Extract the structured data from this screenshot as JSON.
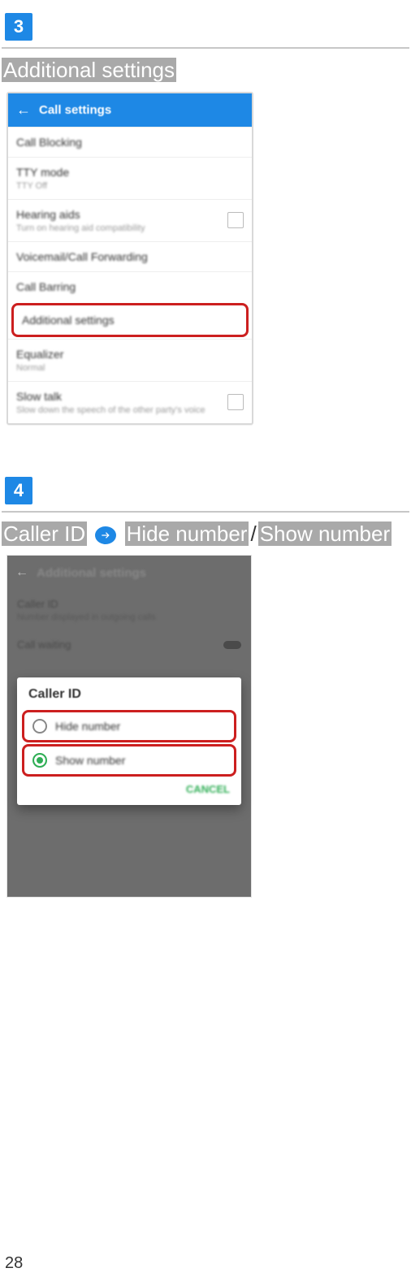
{
  "step3": {
    "badge": "3",
    "heading": "Additional settings",
    "screenshot": {
      "title": "Call settings",
      "items": {
        "call_blocking": "Call Blocking",
        "tty_mode": "TTY mode",
        "tty_mode_sub": "TTY Off",
        "hearing_aids": "Hearing aids",
        "hearing_aids_sub": "Turn on hearing aid compatibility",
        "voicemail_fwd": "Voicemail/Call Forwarding",
        "call_barring": "Call Barring",
        "additional_settings": "Additional settings",
        "equalizer": "Equalizer",
        "equalizer_sub": "Normal",
        "slow_talk": "Slow talk",
        "slow_talk_sub": "Slow down the speech of the other party's voice"
      }
    }
  },
  "step4": {
    "badge": "4",
    "heading_parts": {
      "caller_id": "Caller ID",
      "hide": "Hide number",
      "slash": "/",
      "show": "Show number"
    },
    "screenshot": {
      "title": "Additional settings",
      "caller_id": "Caller ID",
      "caller_id_sub": "Number displayed in outgoing calls",
      "call_waiting": "Call waiting",
      "dialog_title": "Caller ID",
      "opt_hide": "Hide number",
      "opt_show": "Show number",
      "cancel": "CANCEL"
    }
  },
  "page_number": "28"
}
